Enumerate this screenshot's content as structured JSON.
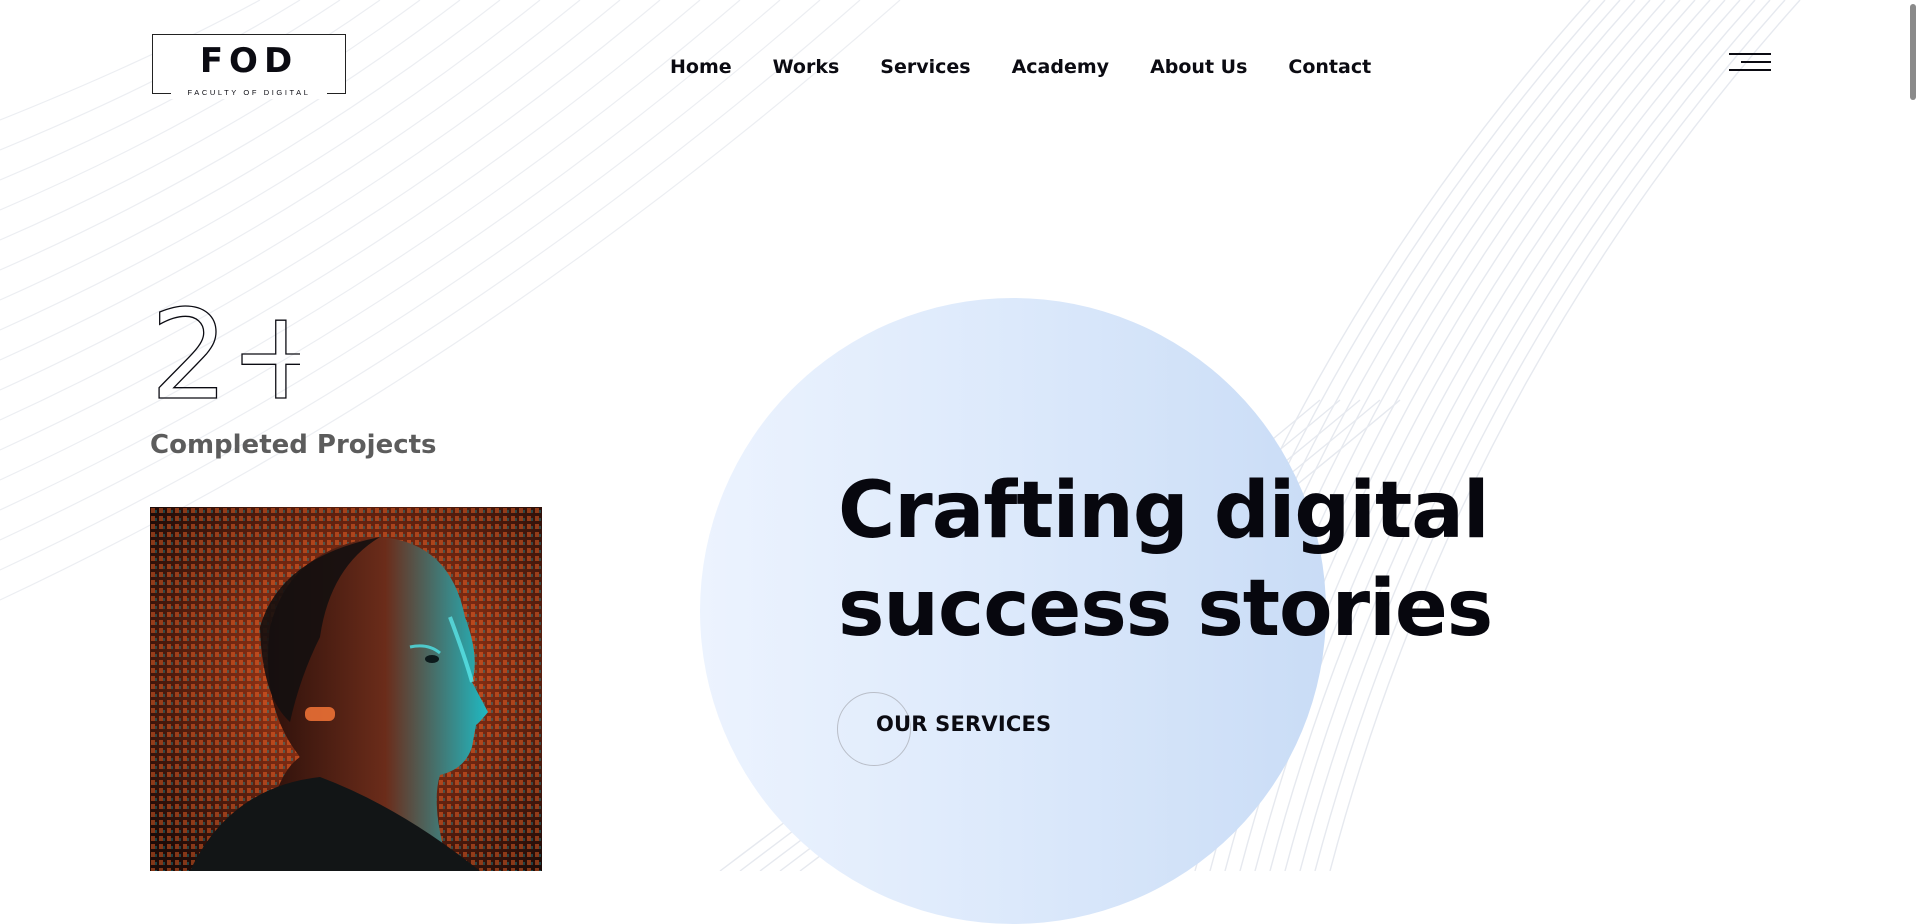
{
  "logo": {
    "main": "FOD",
    "subtitle": "FACULTY OF DIGITAL"
  },
  "nav": {
    "items": [
      {
        "label": "Home"
      },
      {
        "label": "Works"
      },
      {
        "label": "Services"
      },
      {
        "label": "Academy"
      },
      {
        "label": "About Us"
      },
      {
        "label": "Contact"
      }
    ]
  },
  "stats": {
    "number": "2+",
    "label": "Completed Projects"
  },
  "hero": {
    "headline_line1": "Crafting digital",
    "headline_line2": "success stories",
    "cta_label": "OUR SERVICES"
  },
  "colors": {
    "text": "#0b0b12",
    "muted": "#5c5c5c",
    "circle_light": "#ecf3fe",
    "circle_dark": "#c9dcf6"
  },
  "icons": {
    "menu": "hamburger-menu-icon"
  }
}
